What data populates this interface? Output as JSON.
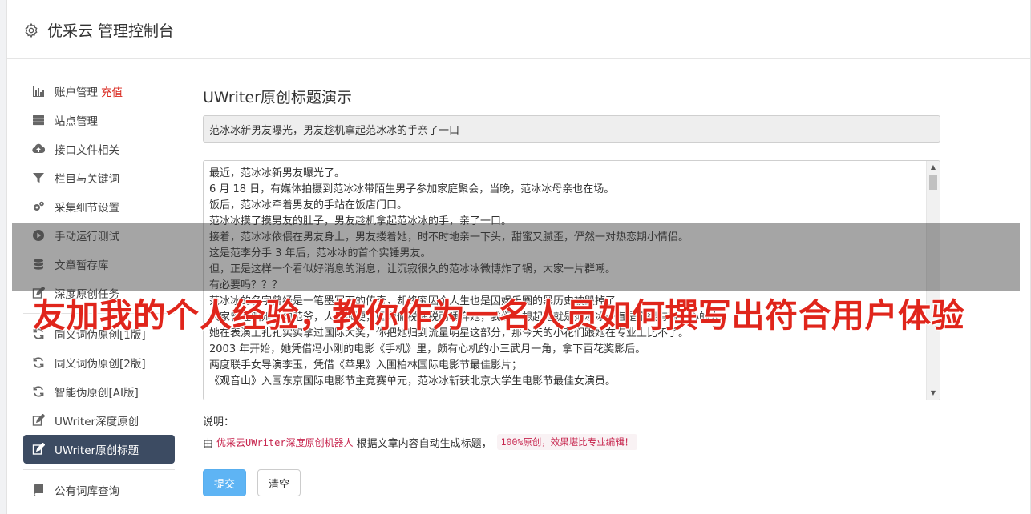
{
  "header": {
    "brand": "优采云 管理控制台",
    "brand_icon": "gear-icon"
  },
  "sidebar": {
    "items": [
      {
        "label": "账户管理",
        "extra": "充值",
        "icon": "bar-chart-icon"
      },
      {
        "label": "站点管理",
        "icon": "server-icon"
      },
      {
        "label": "接口文件相关",
        "icon": "cloud-upload-icon"
      },
      {
        "label": "栏目与关键词",
        "icon": "filter-icon"
      },
      {
        "label": "采集细节设置",
        "icon": "gears-icon"
      },
      {
        "label": "手动运行测试",
        "icon": "play-circle-icon"
      },
      {
        "label": "文章暂存库",
        "icon": "database-icon"
      },
      {
        "label": "深度原创任务",
        "icon": "edit-icon"
      },
      {
        "label": "同义词伪原创[1版]",
        "icon": "refresh-icon"
      },
      {
        "label": "同义词伪原创[2版]",
        "icon": "refresh-icon"
      },
      {
        "label": "智能伪原创[AI版]",
        "icon": "refresh-icon"
      },
      {
        "label": "UWriter深度原创",
        "icon": "edit-icon"
      },
      {
        "label": "UWriter原创标题",
        "icon": "edit-icon",
        "active": true
      },
      {
        "label": "公有词库查询",
        "icon": "book-icon"
      }
    ]
  },
  "main": {
    "title": "UWriter原创标题演示",
    "generated_title": "范冰冰新男友曝光，男友趁机拿起范冰冰的手亲了一口",
    "content_lines": [
      "最近，范冰冰新男友曝光了。",
      "6 月 18 日，有媒体拍摄到范冰冰带陌生男子参加家庭聚会，当晚，范冰冰母亲也在场。",
      "饭后，范冰冰牵着男友的手站在饭店门口。",
      "范冰冰摸了摸男友的肚子，男友趁机拿起范冰冰的手，亲了一口。",
      "接着，范冰冰依偎在男友身上，男友搂着她，时不时地亲一下头，甜蜜又腻歪，俨然一对热恋期小情侣。",
      "这是范李分手 3 年后，范冰冰的首个实锤男友。",
      "但，正是这样一个看似好消息的消息，让沉寂很久的范冰冰微博炸了锅，大家一片群嘲。",
      "有必要吗？？？",
      "范冰冰的名字曾经是一笔墨写下的传奇，却终究因个人生也是因娱乐圈的黑历史被毁掉了。",
      "大家曾经叫她一句范爷，人设很硬，因为偷税漏税而唾弃她，我们一想起她就是范冰冰一直是个很有事业心的人。",
      "她在表演上扎扎实实拿过国际大奖，你把她归到流量明星这部分，那今天的小花们跟她在专业上比不了。",
      "2003 年开始，她凭借冯小刚的电影《手机》里，颇有心机的小三武月一角，拿下百花奖影后。",
      "两度联手女导演李玉，凭借《苹果》入围柏林国际电影节最佳影片；",
      "《观音山》入围东京国际电影节主竞赛单元，范冰冰斩获北京大学生电影节最佳女演员。"
    ],
    "note_label": "说明：",
    "note_prefix": "由",
    "note_code1": "优采云UWriter深度原创机器人",
    "note_middle": "根据文章内容自动生成标题，",
    "note_code2": "100%原创，效果堪比专业编辑！",
    "submit_label": "提交",
    "clear_label": "清空"
  },
  "overlay": {
    "text": "友加我的个人经验，教你作为一名人员如何撰写出符合用户体验"
  }
}
